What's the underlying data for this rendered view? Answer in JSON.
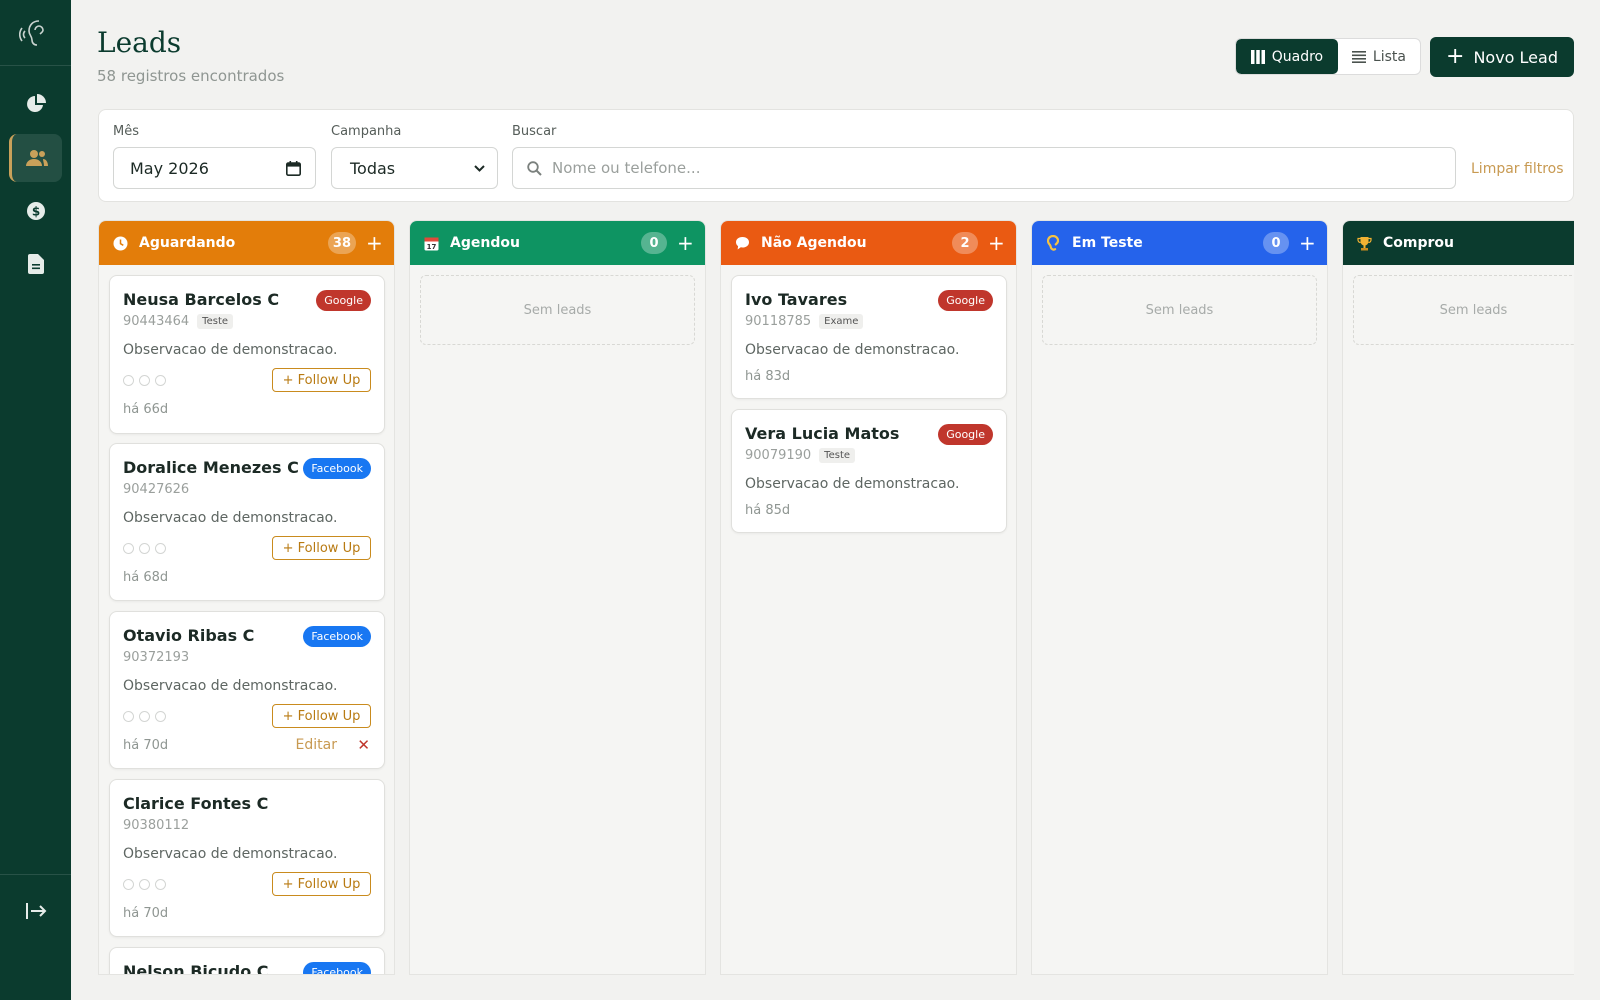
{
  "colors": {
    "brand": "#0b3b2e",
    "aguardando": "#e37d0a",
    "agendou": "#0e9462",
    "nao_agendou": "#ea5a12",
    "em_teste": "#2563eb",
    "comprou": "#0b3b2e",
    "google": "#c0362c",
    "facebook": "#1877f2"
  },
  "sidebar": {
    "icons": [
      "logo-icon",
      "chart-icon",
      "users-icon",
      "dollar-icon",
      "document-icon",
      "logout-icon"
    ]
  },
  "header": {
    "title": "Leads",
    "subtitle": "58 registros encontrados",
    "view_board": "Quadro",
    "view_list": "Lista",
    "new_lead": "Novo Lead"
  },
  "filters": {
    "month_label": "Mês",
    "month_value": "May 2026",
    "campaign_label": "Campanha",
    "campaign_value": "Todas",
    "search_label": "Buscar",
    "search_placeholder": "Nome ou telefone...",
    "clear": "Limpar filtros"
  },
  "columns": [
    {
      "title": "Aguardando",
      "count": "38",
      "icon": "clock-icon",
      "cards": [
        {
          "name": "Neusa Barcelos C",
          "badge": "Google",
          "phone": "90443464",
          "tag": "Teste",
          "obs": "Observacao de demonstracao.",
          "follow": "+ Follow Up",
          "age": "há 66d"
        },
        {
          "name": "Doralice Menezes C",
          "badge": "Facebook",
          "phone": "90427626",
          "obs": "Observacao de demonstracao.",
          "follow": "+ Follow Up",
          "age": "há 68d"
        },
        {
          "name": "Otavio Ribas C",
          "badge": "Facebook",
          "phone": "90372193",
          "obs": "Observacao de demonstracao.",
          "follow": "+ Follow Up",
          "age": "há 70d",
          "edit": "Editar"
        },
        {
          "name": "Clarice Fontes C",
          "phone": "90380112",
          "obs": "Observacao de demonstracao.",
          "follow": "+ Follow Up",
          "age": "há 70d"
        },
        {
          "name": "Nelson Bicudo C",
          "badge": "Facebook"
        }
      ]
    },
    {
      "title": "Agendou",
      "count": "0",
      "icon": "calendar-icon",
      "empty": "Sem leads"
    },
    {
      "title": "Não Agendou",
      "count": "2",
      "icon": "speech-bubble-icon",
      "cards": [
        {
          "name": "Ivo Tavares",
          "badge": "Google",
          "phone": "90118785",
          "tag": "Exame",
          "obs": "Observacao de demonstracao.",
          "age": "há 83d"
        },
        {
          "name": "Vera Lucia Matos",
          "badge": "Google",
          "phone": "90079190",
          "tag": "Teste",
          "obs": "Observacao de demonstracao.",
          "age": "há 85d"
        }
      ]
    },
    {
      "title": "Em Teste",
      "count": "0",
      "icon": "ear-icon",
      "empty": "Sem leads"
    },
    {
      "title": "Comprou",
      "icon": "trophy-icon",
      "empty": "Sem leads"
    }
  ]
}
